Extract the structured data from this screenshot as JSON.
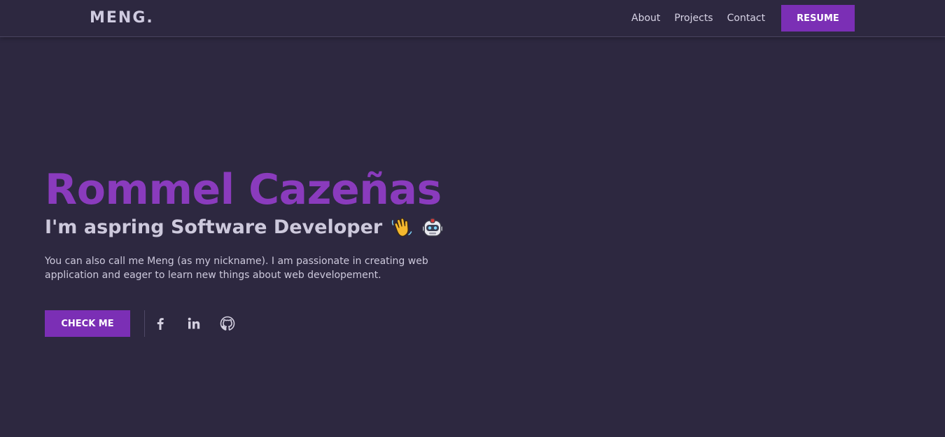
{
  "header": {
    "logo": "MENG.",
    "nav": [
      {
        "label": "About"
      },
      {
        "label": "Projects"
      },
      {
        "label": "Contact"
      }
    ],
    "resume_label": "RESUME"
  },
  "hero": {
    "name": "Rommel Cazeñas",
    "subtitle": "I'm aspring Software Developer",
    "subtitle_icons": [
      "waving-hand-icon",
      "robot-icon"
    ],
    "description": "You can also call me Meng (as my nickname). I am passionate in creating web application and eager to learn new things about web developement.",
    "cta_label": "CHECK ME",
    "socials": [
      {
        "icon": "facebook-icon"
      },
      {
        "icon": "linkedin-icon"
      },
      {
        "icon": "github-icon"
      }
    ]
  },
  "colors": {
    "background": "#2d2840",
    "accent": "#7b2fb5",
    "name": "#8a3bbd",
    "text": "#cdc9dc"
  }
}
